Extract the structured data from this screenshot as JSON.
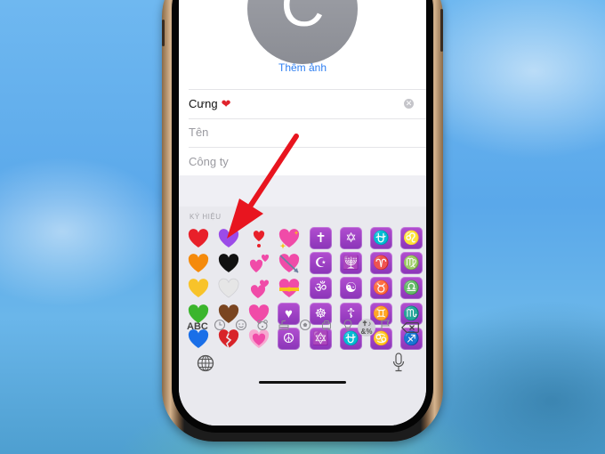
{
  "contact": {
    "avatar_initial": "C",
    "add_photo_label": "Thêm ảnh",
    "nickname_value": "Cưng",
    "nickname_emoji": "❤",
    "first_name_placeholder": "Tên",
    "company_placeholder": "Công ty"
  },
  "keyboard": {
    "section_label": "KÝ HIỆU",
    "hearts_columns": [
      [
        "red-heart",
        "orange-heart",
        "yellow-heart",
        "green-heart",
        "blue-heart"
      ],
      [
        "purple-heart",
        "black-heart",
        "white-heart",
        "brown-heart",
        "broken-heart"
      ],
      [
        "heart-exclamation",
        "two-hearts",
        "revolving-hearts",
        "beating-heart",
        "growing-heart"
      ],
      [
        "sparkling-heart",
        "heart-with-arrow",
        "heart-with-ribbon",
        "heart-decoration",
        "peace-symbol"
      ]
    ],
    "heart_colors": {
      "red-heart": "#e8202a",
      "orange-heart": "#f58a0b",
      "yellow-heart": "#f8c32a",
      "green-heart": "#3bb52c",
      "blue-heart": "#1a6fe8",
      "purple-heart": "#9b4be8",
      "black-heart": "#111111",
      "white-heart": "#e6e6e6",
      "brown-heart": "#7a4520",
      "broken-heart": "#d8242a"
    },
    "symbols": [
      [
        "✝",
        "✡",
        "⛎",
        "♌"
      ],
      [
        "☪",
        "🕎",
        "♈",
        "♍"
      ],
      [
        "ॐ",
        "☯",
        "♉",
        "♎"
      ],
      [
        "☸",
        "☦",
        "♊",
        "♏"
      ],
      [
        "🔯",
        "⛎",
        "♋",
        "♐"
      ]
    ],
    "symbol_names": [
      [
        "latin-cross",
        "star-of-david",
        "ophiuchus",
        "leo"
      ],
      [
        "star-and-crescent",
        "menorah",
        "aries",
        "virgo"
      ],
      [
        "om",
        "yin-yang",
        "taurus",
        "libra"
      ],
      [
        "wheel-of-dharma",
        "orthodox-cross",
        "gemini",
        "scorpio"
      ],
      [
        "six-pointed-star",
        "place-of-worship",
        "cancer",
        "sagittarius"
      ]
    ],
    "extra_symbols": {
      "heart-decoration": "♥",
      "peace-symbol": "☮"
    },
    "categories": {
      "abc_label": "ABC",
      "active_label": "✝♪\n&%",
      "items": [
        "recent",
        "smileys",
        "animals",
        "food",
        "activity",
        "travel",
        "objects",
        "symbols",
        "flags"
      ]
    }
  },
  "annotation": {
    "arrow_color": "#e8151f"
  }
}
